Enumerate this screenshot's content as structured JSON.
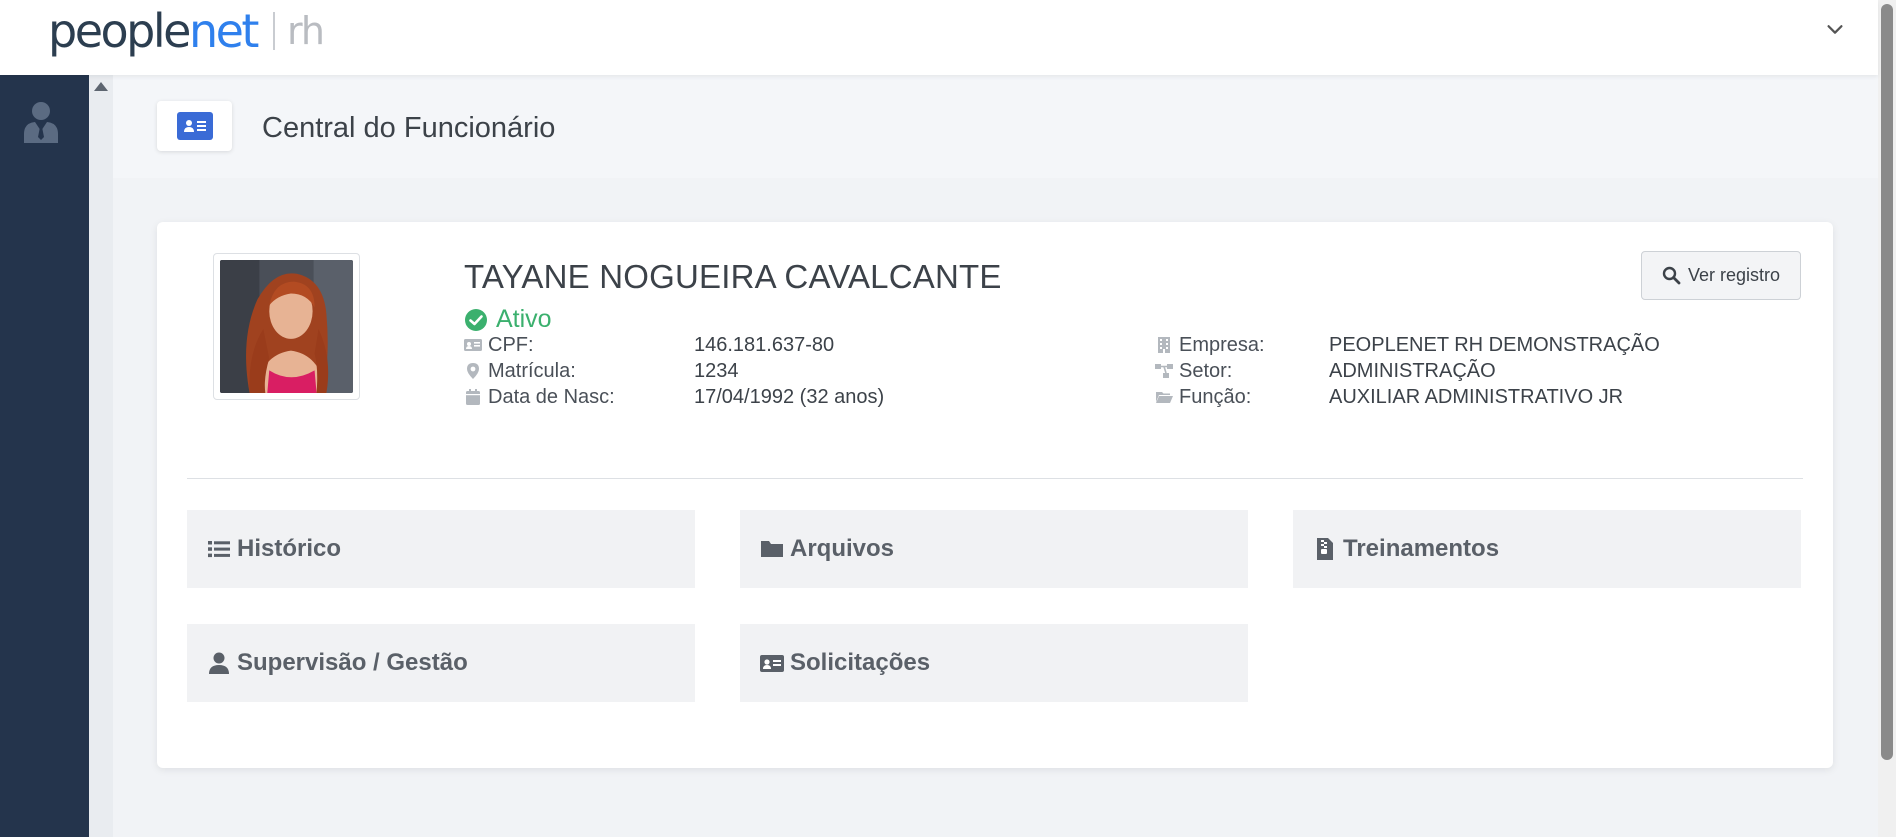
{
  "app": {
    "logo_people": "people",
    "logo_net": "net",
    "logo_rh": "rh"
  },
  "page": {
    "title": "Central do Funcionário"
  },
  "employee": {
    "name": "TAYANE NOGUEIRA CAVALCANTE",
    "status": "Ativo",
    "fields": {
      "cpf_label": "CPF:",
      "cpf_value": "146.181.637-80",
      "matricula_label": "Matrícula:",
      "matricula_value": "1234",
      "nasc_label": "Data de Nasc:",
      "nasc_value": "17/04/1992 (32 anos)",
      "empresa_label": "Empresa:",
      "empresa_value": "PEOPLENET RH DEMONSTRAÇÃO",
      "setor_label": "Setor:",
      "setor_value": "ADMINISTRAÇÃO",
      "funcao_label": "Função:",
      "funcao_value": "AUXILIAR ADMINISTRATIVO JR"
    }
  },
  "actions": {
    "ver_registro": "Ver registro"
  },
  "tiles": {
    "historico": "Histórico",
    "arquivos": "Arquivos",
    "treinamentos": "Treinamentos",
    "supervisao": "Supervisão / Gestão",
    "solicitacoes": "Solicitações"
  },
  "colors": {
    "sidebar": "#24344c",
    "accent": "#3a6bd6",
    "status_active": "#3bb06e"
  }
}
